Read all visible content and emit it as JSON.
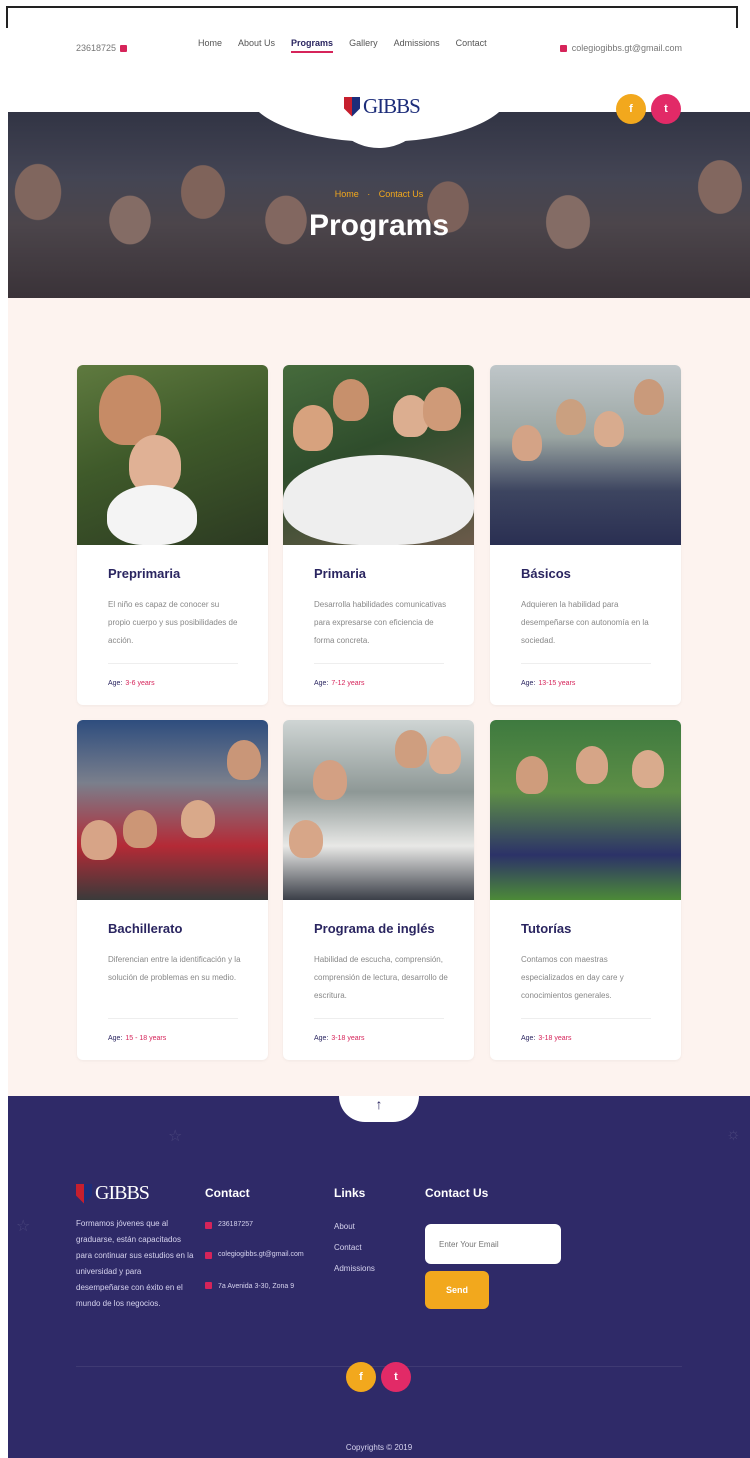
{
  "topbar": {
    "phone": "23618725",
    "email": "colegiogibbs.gt@gmail.com",
    "nav": [
      "Home",
      "About Us",
      "Programs",
      "Gallery",
      "Admissions",
      "Contact"
    ]
  },
  "logo": {
    "text": "GIBBS"
  },
  "social": {
    "facebook": "f",
    "twitter": "t"
  },
  "hero": {
    "breadcrumb_home": "Home",
    "breadcrumb_current": "Contact Us",
    "title": "Programs"
  },
  "programs": [
    {
      "title": "Preprimaria",
      "desc": "El niño es capaz de conocer su propio cuerpo y sus posibilidades de acción.",
      "age_label": "Age:",
      "age_value": "3-6 years"
    },
    {
      "title": "Primaria",
      "desc": "Desarrolla habilidades comunicativas para expresarse con eficiencia de forma concreta.",
      "age_label": "Age:",
      "age_value": "7-12 years"
    },
    {
      "title": "Básicos",
      "desc": "Adquieren la habilidad para desempeñarse con autonomía en la sociedad.",
      "age_label": "Age:",
      "age_value": "13-15 years"
    },
    {
      "title": "Bachillerato",
      "desc": "Diferencian entre la identificación y la solución de problemas en su medio.",
      "age_label": "Age:",
      "age_value": "15 - 18 years"
    },
    {
      "title": "Programa de inglés",
      "desc": "Habilidad de escucha, comprensión, comprensión de lectura, desarrollo de escritura.",
      "age_label": "Age:",
      "age_value": "3-18 years"
    },
    {
      "title": "Tutorías",
      "desc": "Contamos con maestras especializados en day care y conocimientos generales.",
      "age_label": "Age:",
      "age_value": "3-18 years"
    }
  ],
  "footer": {
    "about": "Formamos jóvenes que al graduarse, están capacitados para continuar sus estudios en la universidad y para desempeñarse con éxito en el mundo de los negocios.",
    "contact_heading": "Contact",
    "contact_phone": "236187257",
    "contact_email": "colegiogibbs.gt@gmail.com",
    "contact_address": "7a Avenida 3-30, Zona 9",
    "links_heading": "Links",
    "links": [
      "About",
      "Contact",
      "Admissions"
    ],
    "contactus_heading": "Contact Us",
    "email_placeholder": "Enter Your Email",
    "send_label": "Send",
    "copyright": "Copyrights © 2019"
  },
  "colors": {
    "brand_navy": "#2a2560",
    "accent_orange": "#f2a81d",
    "accent_pink": "#e22a67",
    "footer_bg": "#2f2a68",
    "section_bg": "#fdf3ef"
  }
}
